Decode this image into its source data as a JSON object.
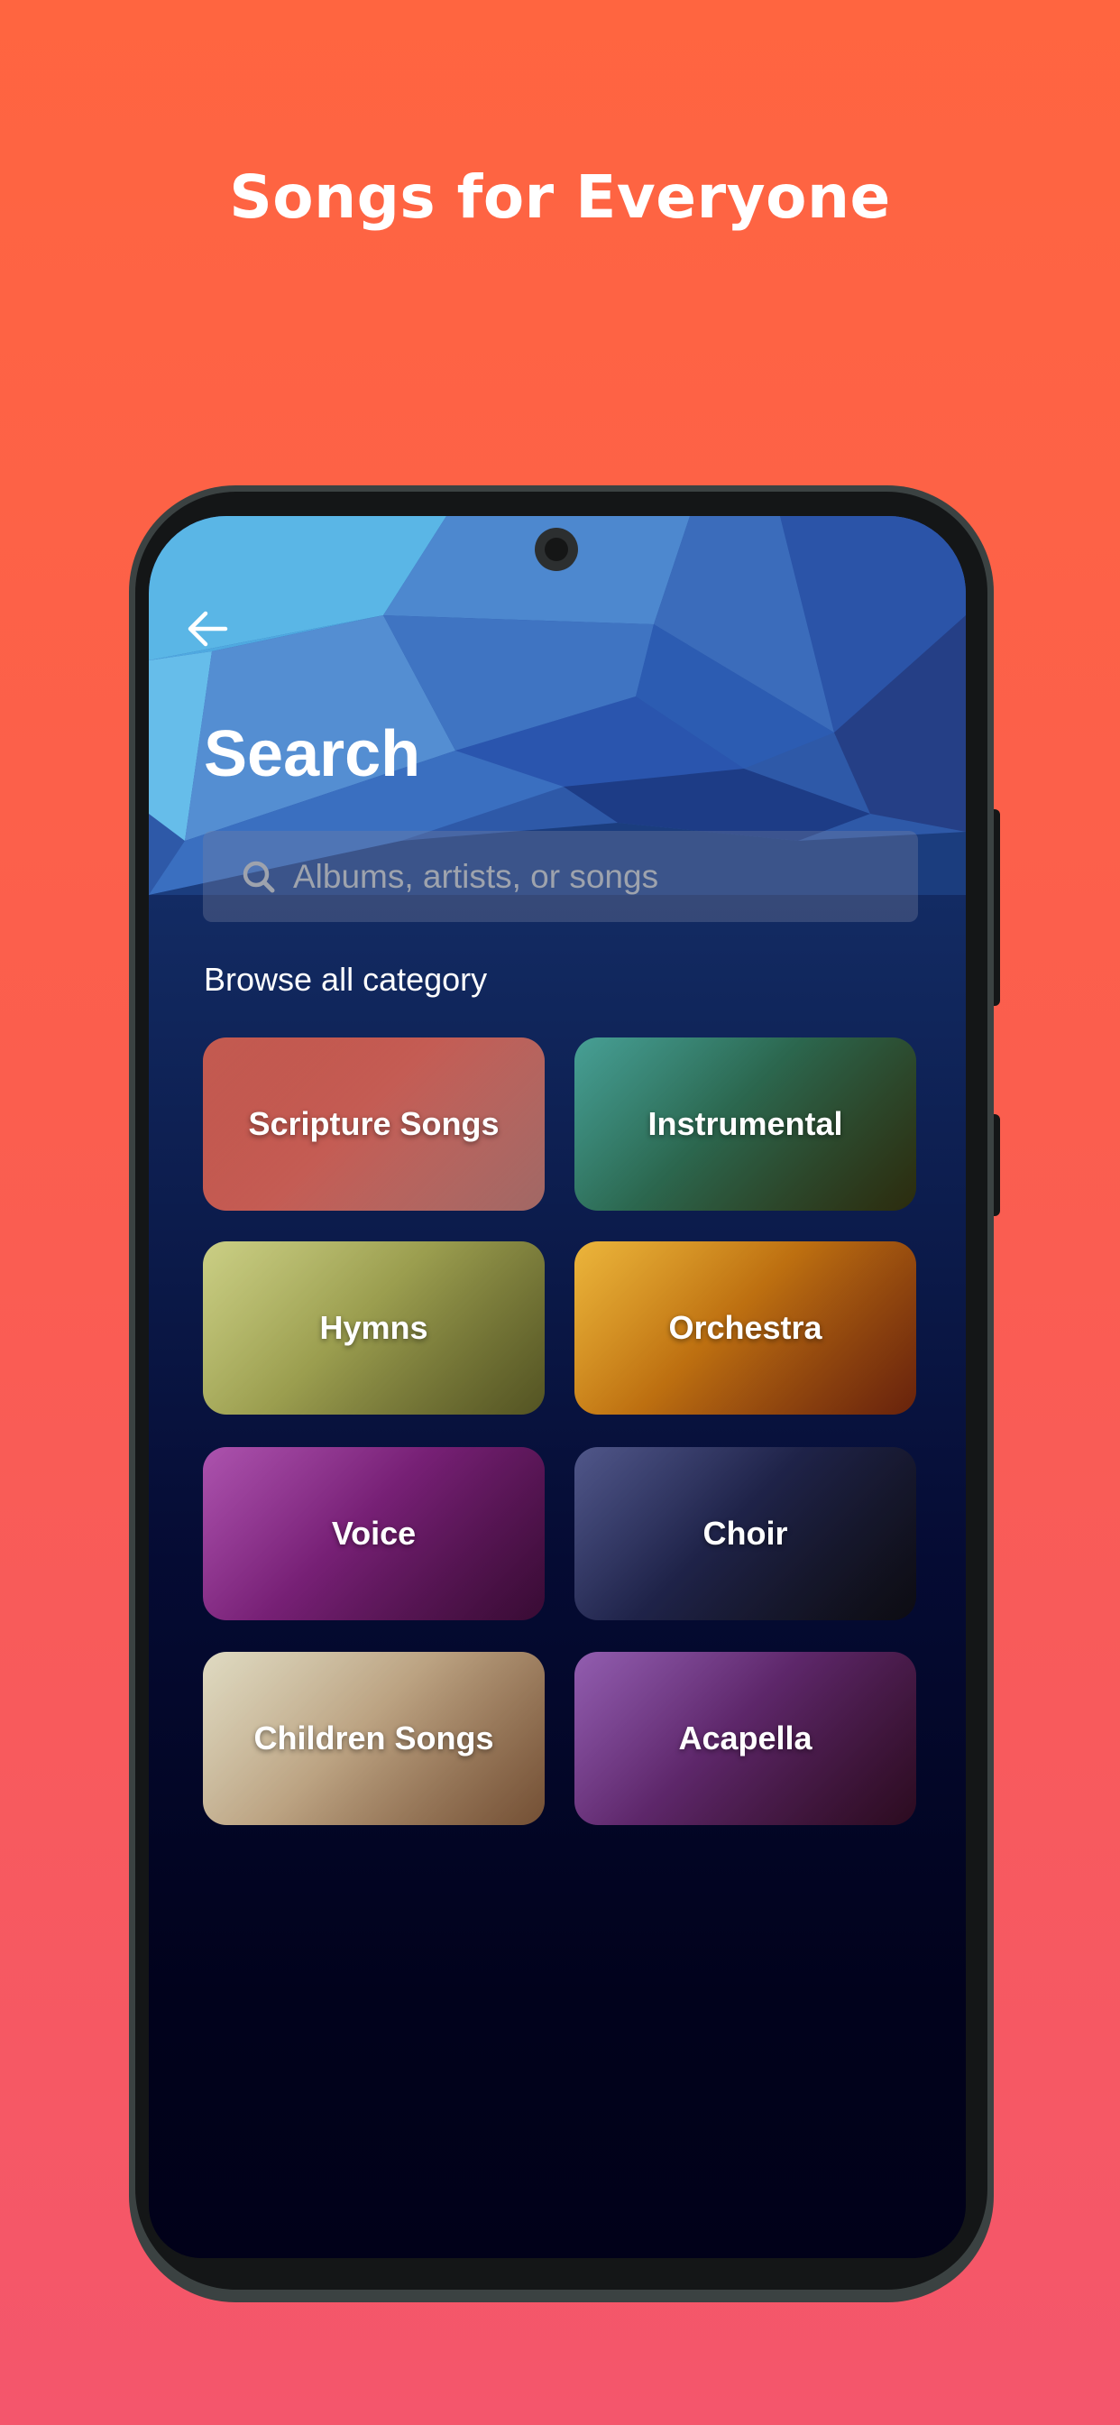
{
  "promo": {
    "headline": "Songs for Everyone"
  },
  "colors": {
    "background_top": "#ff6540",
    "background_bottom": "#f4566c",
    "screen_top": "#1b3d7e",
    "screen_bottom": "#01021c"
  },
  "header": {
    "back_icon": "arrow-left-icon",
    "title": "Search"
  },
  "search": {
    "icon": "search-icon",
    "value": "",
    "placeholder": "Albums, artists, or songs"
  },
  "browse": {
    "heading": "Browse all category",
    "categories": [
      {
        "label": "Scripture Songs",
        "color_a": "#b6362a",
        "color_b": "#d68a86"
      },
      {
        "label": "Instrumental",
        "color_a": "#1f8a7e",
        "color_b": "#3a3a12"
      },
      {
        "label": "Hymns",
        "color_a": "#bfc46a",
        "color_b": "#6f6f2e"
      },
      {
        "label": "Orchestra",
        "color_a": "#e7a511",
        "color_b": "#8a2e10"
      },
      {
        "label": "Voice",
        "color_a": "#9a2d9c",
        "color_b": "#4b0f45"
      },
      {
        "label": "Choir",
        "color_a": "#2a3270",
        "color_b": "#111018"
      },
      {
        "label": "Children Songs",
        "color_a": "#d8d2b4",
        "color_b": "#9a6a46"
      },
      {
        "label": "Acapella",
        "color_a": "#7a3a9e",
        "color_b": "#3a0f2a"
      }
    ]
  }
}
